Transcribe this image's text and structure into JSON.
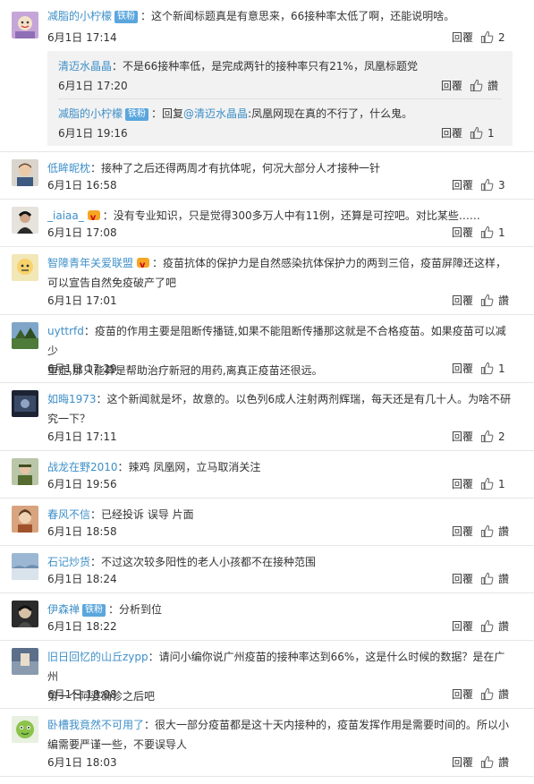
{
  "ui": {
    "reply_label": "回覆",
    "like_label": "讚"
  },
  "comments": [
    {
      "user": "减脂的小柠檬",
      "badge": "铁粉",
      "text": "：这个新闻标题真是有意思来，66接种率太低了啊，还能说明啥。",
      "time": "6月1日 17:14",
      "likes": "2",
      "subreplies": [
        {
          "user": "清迈水晶晶",
          "text": "：不是66接种率低，是完成两针的接种率只有21%，凤凰标题党",
          "time": "6月1日 17:20"
        },
        {
          "user": "减脂的小柠檬",
          "badge": "铁粉",
          "text_prefix": "：回复",
          "mention": "@清迈水晶晶",
          "text": ":凤凰网现在真的不行了，什么鬼。",
          "time": "6月1日 19:16",
          "likes": "1"
        }
      ]
    },
    {
      "user": "低眸昵枕",
      "text": "：接种了之后还得两周才有抗体呢，何况大部分人才接种一针",
      "time": "6月1日 16:58",
      "likes": "3"
    },
    {
      "user": "_iaiaa_",
      "vip": true,
      "text": "：没有专业知识，只是觉得300多万人中有11例，还算是可控吧。对比某些……",
      "time": "6月1日 17:08",
      "likes": "1"
    },
    {
      "user": "智障青年关爱联盟",
      "vip": true,
      "text_line1": "：疫苗抗体的保护力是自然感染抗体保护力的两到三倍，疫苗屏障还这样，",
      "text_line2": "可以宣告自然免疫破产了吧",
      "time": "6月1日 17:01"
    },
    {
      "user": "uyttrfd",
      "text_line1": "：疫苗的作用主要是阻断传播链,如果不能阻断传播那这就是不合格疫苗。如果疫苗可以减少",
      "text_line2": "重症,那只能算是帮助治疗新冠的用药,离真正疫苗还很远。",
      "time": "6月1日 17:29",
      "likes": "1"
    },
    {
      "user": "如晦1973",
      "text_line1": "：这个新闻就是坏，故意的。以色列6成人注射两剂辉瑞，每天还是有几十人。为啥不研",
      "text_line2": "究一下？",
      "time": "6月1日 17:11",
      "likes": "2"
    },
    {
      "user": "战龙在野2010",
      "text": "：辣鸡 凤凰网，立马取消关注",
      "time": "6月1日 19:56",
      "likes": "1"
    },
    {
      "user": "春风不信",
      "text": "：已经投诉 误导 片面",
      "time": "6月1日 18:58"
    },
    {
      "user": "石记炒货",
      "text": "：不过这次较多阳性的老人小孩都不在接种范围",
      "time": "6月1日 18:24"
    },
    {
      "user": "伊森禅",
      "badge": "铁粉",
      "text": "：分析到位",
      "time": "6月1日 18:22"
    },
    {
      "user": "旧日回忆的山丘zypp",
      "text_line1": "：请问小编你说广州疫苗的接种率达到66%，这是什么时候的数据？是在广州",
      "text_line2": "第一个阿婆确诊之后吧",
      "time": "6月1日 18:08"
    },
    {
      "user": "卧槽我竟然不可用了",
      "text_line1": "：很大一部分疫苗都是这十天内接种的，疫苗发挥作用是需要时间的。所以小",
      "text_line2": "编需要严谨一些，不要误导人",
      "time": "6月1日 18:03"
    }
  ]
}
